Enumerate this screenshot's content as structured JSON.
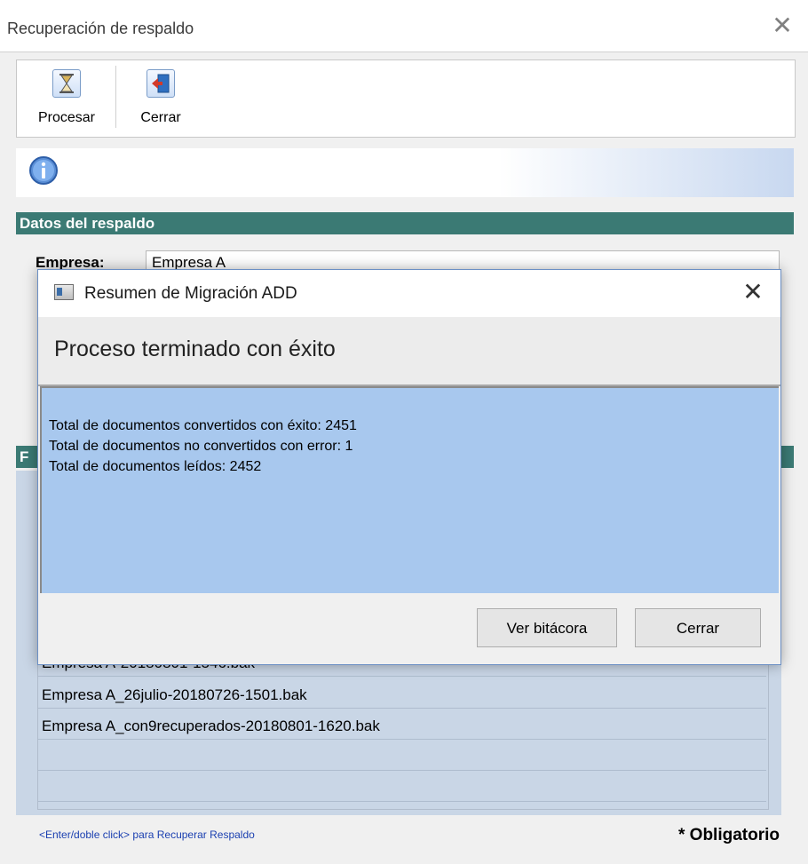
{
  "main_window": {
    "title": "Recuperación de respaldo",
    "close_glyph": "✕"
  },
  "toolbar": {
    "procesar_label": "Procesar",
    "cerrar_label": "Cerrar",
    "procesar_icon": "hourglass-icon",
    "cerrar_icon": "exit-door-icon"
  },
  "info_bar": {
    "icon": "info-icon"
  },
  "sections": {
    "datos_title": "Datos del respaldo",
    "partial_letter": "F"
  },
  "company": {
    "label": "Empresa:",
    "value": "Empresa A"
  },
  "backups": [
    "Empresa A-20180801-1546.bak",
    "Empresa A_26julio-20180726-1501.bak",
    "Empresa A_con9recuperados-20180801-1620.bak",
    "",
    ""
  ],
  "footer": {
    "hint": "<Enter/doble click> para Recuperar Respaldo",
    "required": "* Obligatorio"
  },
  "dialog": {
    "title": "Resumen de Migración ADD",
    "close_glyph": "✕",
    "heading": "Proceso terminado con éxito",
    "lines": [
      "Total de documentos convertidos con éxito: 2451",
      "Total de documentos no convertidos con error: 1",
      "Total de documentos leídos: 2452"
    ],
    "buttons": {
      "log": "Ver bitácora",
      "close": "Cerrar"
    }
  },
  "colors": {
    "section_header": "#3b7a74",
    "dialog_body": "#a8c8ee",
    "list_bg": "#c9d6e6"
  }
}
